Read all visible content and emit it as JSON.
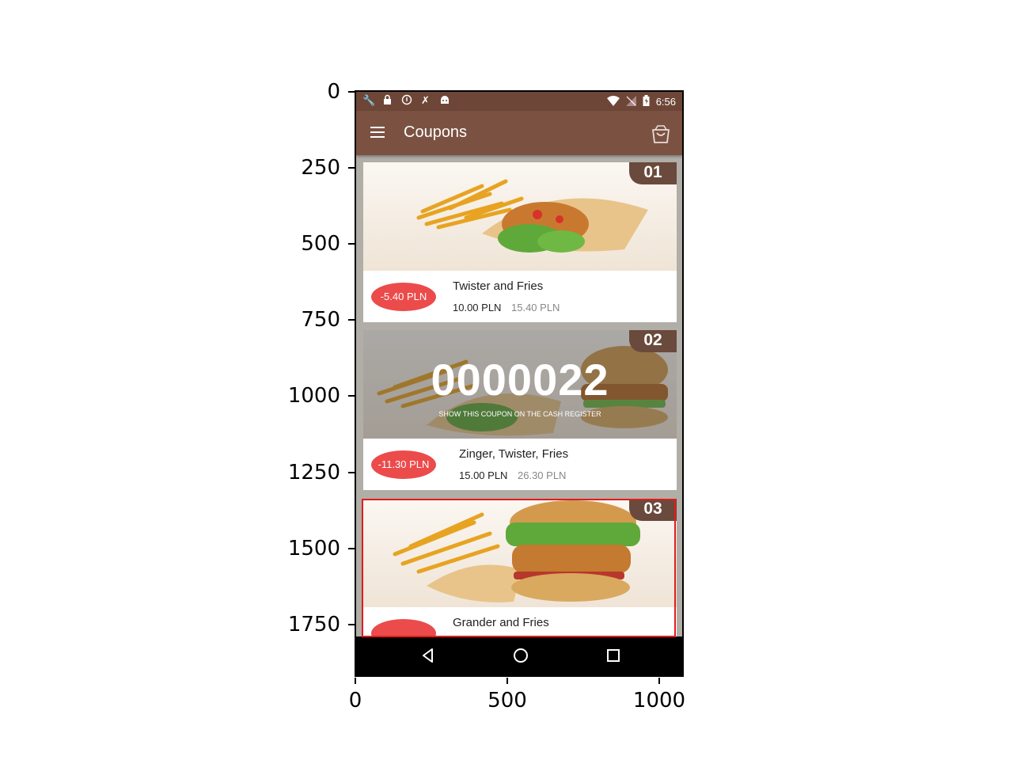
{
  "axes": {
    "y_ticks": [
      "0",
      "250",
      "500",
      "750",
      "1000",
      "1250",
      "1500",
      "1750"
    ],
    "x_ticks": [
      "0",
      "500",
      "1000"
    ]
  },
  "statusbar": {
    "time": "6:56",
    "left_icons": [
      "wrench-icon",
      "lock-icon",
      "info-icon",
      "tools-icon",
      "android-icon"
    ],
    "right_icons": [
      "wifi-icon",
      "no-signal-icon",
      "battery-icon"
    ]
  },
  "appbar": {
    "title": "Coupons",
    "color": "#7b5242"
  },
  "coupons": [
    {
      "number": "01",
      "discount": "-5.40 PLN",
      "name": "Twister and Fries",
      "price": "10.00 PLN",
      "old_price": "15.40 PLN",
      "activated": false
    },
    {
      "number": "02",
      "discount": "-11.30 PLN",
      "name": "Zinger, Twister, Fries",
      "price": "15.00 PLN",
      "old_price": "26.30 PLN",
      "activated": true,
      "code": "0000022",
      "code_hint": "SHOW THIS COUPON ON THE CASH REGISTER"
    },
    {
      "number": "03",
      "discount": "",
      "name": "Grander and Fries",
      "price": "",
      "old_price": "",
      "activated": false
    }
  ],
  "colors": {
    "accent_red": "#ec4b4b",
    "badge_brown": "#6a4a3c",
    "highlight": "#e31a1c"
  }
}
